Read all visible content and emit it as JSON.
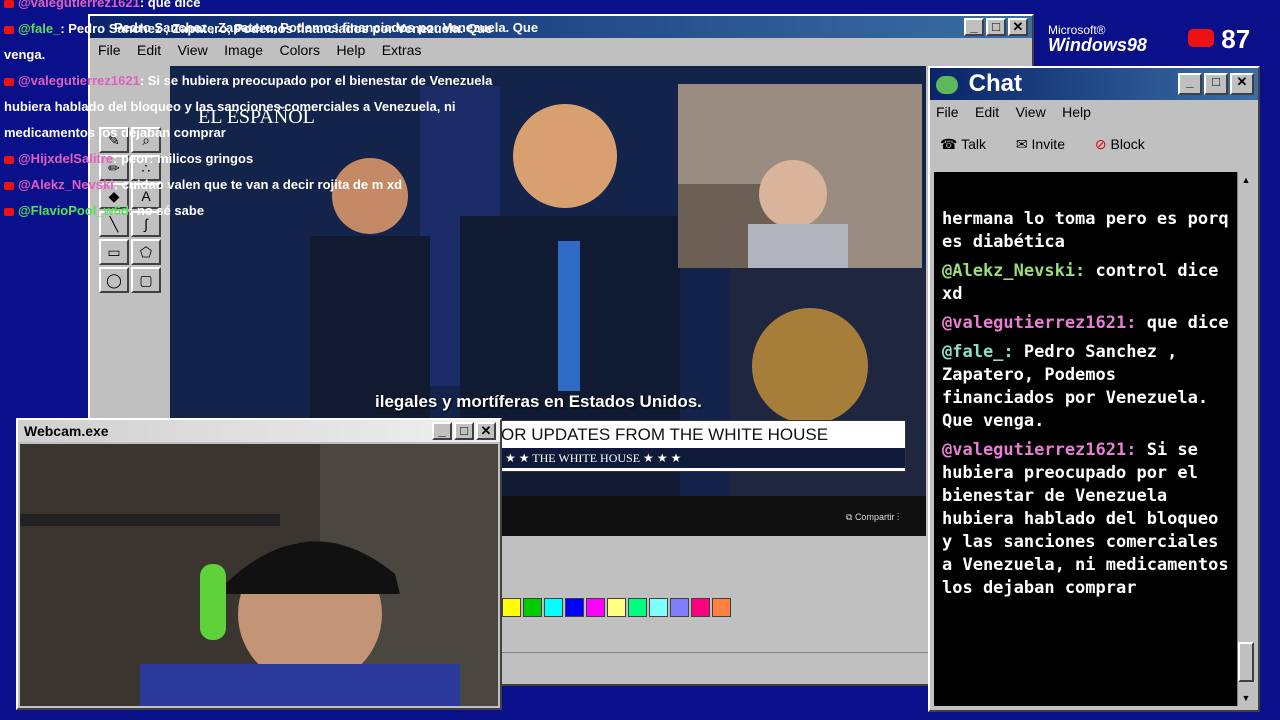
{
  "paint": {
    "title": "Pedro Sanchez , Zapatero, Podemos financiados por Venezuela. Que",
    "menu": [
      "File",
      "Edit",
      "View",
      "Image",
      "Colors",
      "Help",
      "Extras"
    ],
    "palette": [
      "#ffff00",
      "#00cc00",
      "#00ffff",
      "#0000ff",
      "#ff00ff",
      "#ffff80",
      "#00ff80",
      "#80ffff",
      "#8080ff",
      "#ff0080",
      "#ff8040"
    ]
  },
  "overlay_chat": [
    {
      "user": "@valegutierrez1621",
      "text": ": que dice"
    },
    {
      "user": "@fale_",
      "text": ": Pedro Sanchez , Zapatero, Podemos financiados por Venezuela. Que"
    },
    {
      "user": "",
      "text": "venga."
    },
    {
      "user": "@valegutierrez1621",
      "text": ": Si se hubiera preocupado por el bienestar de Venezuela"
    },
    {
      "user": "",
      "text": "hubiera hablado del bloqueo y las sanciones comerciales a Venezuela, ni"
    },
    {
      "user": "",
      "text": "medicamentos los dejaban comprar"
    },
    {
      "user": "@HijxdelSalitre",
      "text": ": peor: milicos gringos"
    },
    {
      "user": "@Alekz_Nevski",
      "text": ": cuidao valen que te van a decir rojita de m xd"
    },
    {
      "user": "@FlavioPool_w6d",
      "text": ": no sé sabe"
    }
  ],
  "video": {
    "subtitle": "ilegales y mortíferas en Estados Unidos.",
    "banner": "OR UPDATES FROM THE WHITE HOUSE",
    "banner_sub": "★ ★   THE WHITE HOUSE   ★ ★ ★",
    "logo": "EL ESPAÑOL",
    "share": "Compartir"
  },
  "branding": {
    "ms_line1": "Microsoft®",
    "ms_line2": "Windows98",
    "yt_count": "87"
  },
  "webcam": {
    "title": "Webcam.exe"
  },
  "chat_window": {
    "title": "Chat",
    "menu": [
      "File",
      "Edit",
      "View",
      "Help"
    ],
    "toolbar": [
      "Talk",
      "Invite",
      "Block"
    ],
    "messages": [
      {
        "user": "",
        "text": "hermana lo toma pero es porq es diabética",
        "color": "none"
      },
      {
        "user": "@Alekz_Nevski:",
        "text": " control dice xd",
        "color": "green"
      },
      {
        "user": "@valegutierrez1621:",
        "text": " que dice",
        "color": "pink"
      },
      {
        "user": "@fale_:",
        "text": " Pedro Sanchez , Zapatero, Podemos financiados por Venezuela. Que venga.",
        "color": "teal"
      },
      {
        "user": "@valegutierrez1621:",
        "text": " Si se hubiera preocupado por el bienestar de Venezuela hubiera hablado del bloqueo y las sanciones comerciales a Venezuela, ni medicamentos los dejaban comprar",
        "color": "pink"
      }
    ]
  }
}
